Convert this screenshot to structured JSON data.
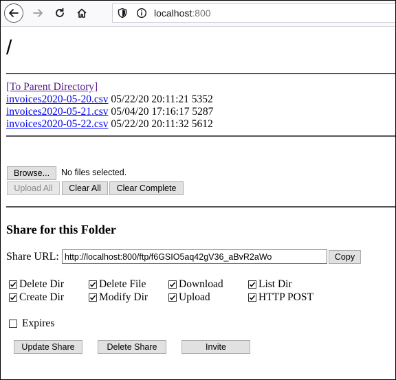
{
  "browser": {
    "url_host": "localhost",
    "url_port": ":800"
  },
  "page": {
    "title": "/",
    "parent_link": "[To Parent Directory]",
    "files": [
      {
        "name": "invoices2020-05-20.csv",
        "date": "05/22/20 20:11:21",
        "size": "5352"
      },
      {
        "name": "invoices2020-05-21.csv",
        "date": "05/04/20 17:16:17",
        "size": "5287"
      },
      {
        "name": "invoices2020-05-22.csv",
        "date": "05/22/20 20:11:32",
        "size": "5612"
      }
    ]
  },
  "upload": {
    "browse_label": "Browse...",
    "file_status": "No files selected.",
    "upload_all_label": "Upload All",
    "clear_all_label": "Clear All",
    "clear_complete_label": "Clear Complete"
  },
  "share": {
    "title": "Share for this Folder",
    "url_label": "Share URL:",
    "url_value": "http://localhost:800/ftp/f6GSIO5aq42gV36_aBvR2aWo",
    "copy_label": "Copy",
    "permissions": [
      {
        "label": "Delete Dir",
        "checked": true
      },
      {
        "label": "Delete File",
        "checked": true
      },
      {
        "label": "Download",
        "checked": true
      },
      {
        "label": "List Dir",
        "checked": true
      },
      {
        "label": "Create Dir",
        "checked": true
      },
      {
        "label": "Modify Dir",
        "checked": true
      },
      {
        "label": "Upload",
        "checked": true
      },
      {
        "label": "HTTP POST",
        "checked": true
      }
    ],
    "expires_label": "Expires",
    "expires_checked": false,
    "update_label": "Update Share",
    "delete_label": "Delete Share",
    "invite_label": "Invite"
  }
}
